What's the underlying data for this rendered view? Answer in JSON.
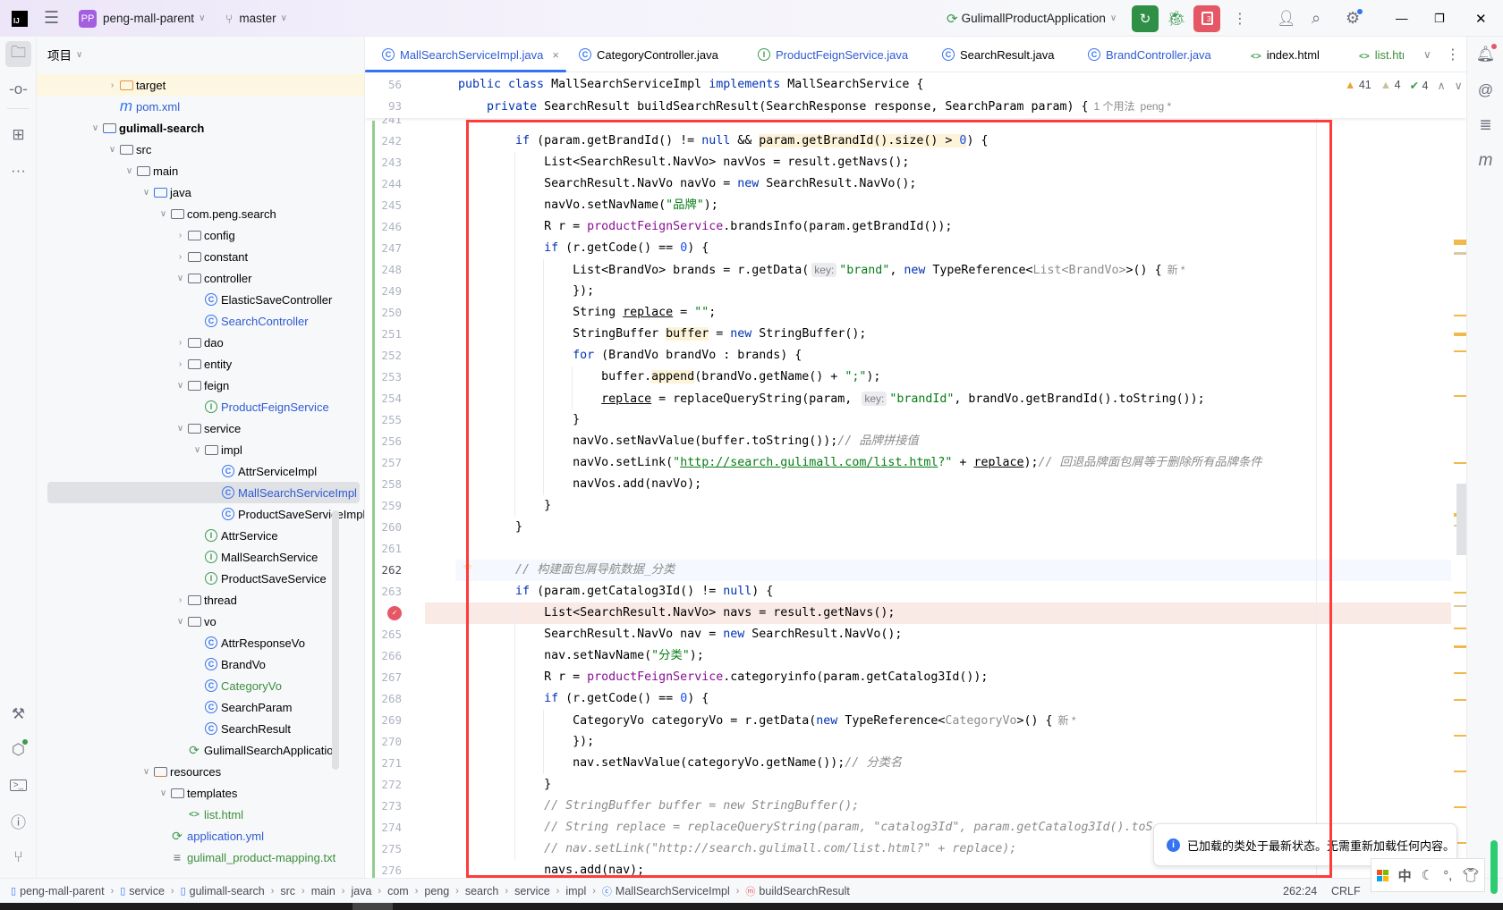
{
  "titlebar": {
    "project_badge": "PP",
    "project_name": "peng-mall-parent",
    "branch": "master",
    "run_config": "GulimallProductApplication",
    "stop_badge": "3"
  },
  "panel": {
    "title": "项目",
    "tree": [
      {
        "label": "target",
        "level": 1,
        "chevron": "closed",
        "icon": "folder-excluded"
      },
      {
        "label": "pom.xml",
        "level": 1,
        "chevron": null,
        "icon": "maven",
        "status": "modified"
      },
      {
        "label": "gulimall-search",
        "level": 0,
        "chevron": "open",
        "icon": "module",
        "bold": true
      },
      {
        "label": "src",
        "level": 1,
        "chevron": "open",
        "icon": "folder"
      },
      {
        "label": "main",
        "level": 2,
        "chevron": "open",
        "icon": "folder"
      },
      {
        "label": "java",
        "level": 3,
        "chevron": "open",
        "icon": "source-folder"
      },
      {
        "label": "com.peng.search",
        "level": 4,
        "chevron": "open",
        "icon": "package"
      },
      {
        "label": "config",
        "level": 5,
        "chevron": "closed",
        "icon": "package"
      },
      {
        "label": "constant",
        "level": 5,
        "chevron": "closed",
        "icon": "package"
      },
      {
        "label": "controller",
        "level": 5,
        "chevron": "open",
        "icon": "package"
      },
      {
        "label": "ElasticSaveController",
        "level": 6,
        "chevron": null,
        "icon": "class"
      },
      {
        "label": "SearchController",
        "level": 6,
        "chevron": null,
        "icon": "class",
        "status": "modified"
      },
      {
        "label": "dao",
        "level": 5,
        "chevron": "closed",
        "icon": "package"
      },
      {
        "label": "entity",
        "level": 5,
        "chevron": "closed",
        "icon": "package"
      },
      {
        "label": "feign",
        "level": 5,
        "chevron": "open",
        "icon": "package"
      },
      {
        "label": "ProductFeignService",
        "level": 6,
        "chevron": null,
        "icon": "interface",
        "status": "modified"
      },
      {
        "label": "service",
        "level": 5,
        "chevron": "open",
        "icon": "package"
      },
      {
        "label": "impl",
        "level": 6,
        "chevron": "open",
        "icon": "package"
      },
      {
        "label": "AttrServiceImpl",
        "level": 7,
        "chevron": null,
        "icon": "class"
      },
      {
        "label": "MallSearchServiceImpl",
        "level": 7,
        "chevron": null,
        "icon": "class",
        "status": "modified",
        "selected": true
      },
      {
        "label": "ProductSaveServiceImpl",
        "level": 7,
        "chevron": null,
        "icon": "class"
      },
      {
        "label": "AttrService",
        "level": 6,
        "chevron": null,
        "icon": "interface"
      },
      {
        "label": "MallSearchService",
        "level": 6,
        "chevron": null,
        "icon": "interface"
      },
      {
        "label": "ProductSaveService",
        "level": 6,
        "chevron": null,
        "icon": "interface"
      },
      {
        "label": "thread",
        "level": 5,
        "chevron": "closed",
        "icon": "package"
      },
      {
        "label": "vo",
        "level": 5,
        "chevron": "open",
        "icon": "package"
      },
      {
        "label": "AttrResponseVo",
        "level": 6,
        "chevron": null,
        "icon": "class"
      },
      {
        "label": "BrandVo",
        "level": 6,
        "chevron": null,
        "icon": "class"
      },
      {
        "label": "CategoryVo",
        "level": 6,
        "chevron": null,
        "icon": "class",
        "status": "added"
      },
      {
        "label": "SearchParam",
        "level": 6,
        "chevron": null,
        "icon": "class"
      },
      {
        "label": "SearchResult",
        "level": 6,
        "chevron": null,
        "icon": "class"
      },
      {
        "label": "GulimallSearchApplication",
        "level": 5,
        "chevron": null,
        "icon": "spring-boot"
      },
      {
        "label": "resources",
        "level": 3,
        "chevron": "open",
        "icon": "resources-folder"
      },
      {
        "label": "templates",
        "level": 4,
        "chevron": "open",
        "icon": "folder"
      },
      {
        "label": "list.html",
        "level": 5,
        "chevron": null,
        "icon": "html",
        "status": "added"
      },
      {
        "label": "application.yml",
        "level": 4,
        "chevron": null,
        "icon": "yaml",
        "status": "modified"
      },
      {
        "label": "gulimall_product-mapping.txt",
        "level": 4,
        "chevron": null,
        "icon": "text",
        "status": "added"
      }
    ]
  },
  "tabs": [
    {
      "label": "MallSearchServiceImpl.java",
      "icon": "class",
      "active": true,
      "status": "modified"
    },
    {
      "label": "CategoryController.java",
      "icon": "class"
    },
    {
      "label": "ProductFeignService.java",
      "icon": "interface",
      "status": "modified"
    },
    {
      "label": "SearchResult.java",
      "icon": "class"
    },
    {
      "label": "BrandController.java",
      "icon": "class",
      "status": "modified"
    },
    {
      "label": "index.html",
      "icon": "html"
    },
    {
      "label": "list.htm",
      "icon": "html",
      "status": "added"
    }
  ],
  "inspections": {
    "warnings": "41",
    "weak_warnings": "4",
    "typos": "4"
  },
  "sticky": [
    {
      "n": "56",
      "tokens": [
        [
          "kw",
          "public class "
        ],
        [
          "p",
          "MallSearchServiceImpl "
        ],
        [
          "kw",
          "implements "
        ],
        [
          "p",
          "MallSearchService {"
        ]
      ]
    },
    {
      "n": "93",
      "tokens": [
        [
          "p",
          "    "
        ],
        [
          "kw",
          "private "
        ],
        [
          "p",
          "SearchResult buildSearchResult(SearchResponse response, SearchParam param) {"
        ],
        [
          "author",
          "1 个用法"
        ],
        [
          "author",
          "peng *"
        ]
      ]
    }
  ],
  "code": [
    {
      "n": "241",
      "tokens": []
    },
    {
      "n": "242",
      "tokens": [
        [
          "p",
          "        "
        ],
        [
          "kw",
          "if"
        ],
        [
          "p",
          " (param.getBrandId() != "
        ],
        [
          "kw",
          "null"
        ],
        [
          "p",
          " && "
        ],
        [
          "hl",
          "param.getBrandId().size() > "
        ],
        [
          "hlnum",
          "0"
        ],
        [
          "p",
          ") {"
        ]
      ]
    },
    {
      "n": "243",
      "tokens": [
        [
          "p",
          "            List<SearchResult.NavVo> navVos = result.getNavs();"
        ]
      ]
    },
    {
      "n": "244",
      "tokens": [
        [
          "p",
          "            SearchResult.NavVo navVo = "
        ],
        [
          "kw",
          "new"
        ],
        [
          "p",
          " SearchResult.NavVo();"
        ]
      ]
    },
    {
      "n": "245",
      "tokens": [
        [
          "p",
          "            navVo.setNavName("
        ],
        [
          "str",
          "\"品牌\""
        ],
        [
          "p",
          ");"
        ]
      ]
    },
    {
      "n": "246",
      "tokens": [
        [
          "p",
          "            R r = "
        ],
        [
          "fld",
          "productFeignService"
        ],
        [
          "p",
          ".brandsInfo(param.getBrandId());"
        ]
      ]
    },
    {
      "n": "247",
      "tokens": [
        [
          "p",
          "            "
        ],
        [
          "kw",
          "if"
        ],
        [
          "p",
          " (r.getCode() == "
        ],
        [
          "num",
          "0"
        ],
        [
          "p",
          ") {"
        ]
      ]
    },
    {
      "n": "248",
      "tokens": [
        [
          "p",
          "                List<BrandVo> brands = r.getData("
        ],
        [
          "hint",
          "key:"
        ],
        [
          "str",
          "\"brand\""
        ],
        [
          "p",
          ", "
        ],
        [
          "kw",
          "new"
        ],
        [
          "p",
          " TypeReference<"
        ],
        [
          "grey",
          "List<BrandVo>"
        ],
        [
          "p",
          ">() {"
        ],
        [
          "author",
          "新 *"
        ]
      ]
    },
    {
      "n": "249",
      "tokens": [
        [
          "p",
          "                });"
        ]
      ]
    },
    {
      "n": "250",
      "tokens": [
        [
          "p",
          "                String "
        ],
        [
          "ul",
          "replace"
        ],
        [
          "p",
          " = "
        ],
        [
          "str",
          "\"\""
        ],
        [
          "p",
          ";"
        ]
      ]
    },
    {
      "n": "251",
      "tokens": [
        [
          "p",
          "                StringBuffer "
        ],
        [
          "hl",
          "buffer"
        ],
        [
          "p",
          " = "
        ],
        [
          "kw",
          "new"
        ],
        [
          "p",
          " StringBuffer();"
        ]
      ]
    },
    {
      "n": "252",
      "tokens": [
        [
          "p",
          "                "
        ],
        [
          "kw",
          "for"
        ],
        [
          "p",
          " (BrandVo brandVo : brands) {"
        ]
      ]
    },
    {
      "n": "253",
      "tokens": [
        [
          "p",
          "                    buffer."
        ],
        [
          "hl",
          "append"
        ],
        [
          "p",
          "(brandVo.getName() + "
        ],
        [
          "str",
          "\";\""
        ],
        [
          "p",
          ");"
        ]
      ]
    },
    {
      "n": "254",
      "tokens": [
        [
          "p",
          "                    "
        ],
        [
          "ul",
          "replace"
        ],
        [
          "p",
          " = replaceQueryString(param, "
        ],
        [
          "hint",
          "key:"
        ],
        [
          "str",
          "\"brandId\""
        ],
        [
          "p",
          ", brandVo.getBrandId().toString());"
        ]
      ]
    },
    {
      "n": "255",
      "tokens": [
        [
          "p",
          "                }"
        ]
      ]
    },
    {
      "n": "256",
      "tokens": [
        [
          "p",
          "                navVo.setNavValue(buffer.toString());"
        ],
        [
          "cm",
          "// 品牌拼接值"
        ]
      ]
    },
    {
      "n": "257",
      "tokens": [
        [
          "p",
          "                navVo.setLink("
        ],
        [
          "str",
          "\""
        ],
        [
          "url",
          "http://search.gulimall.com/list.html"
        ],
        [
          "str",
          "?\""
        ],
        [
          "p",
          " + "
        ],
        [
          "ul",
          "replace"
        ],
        [
          "p",
          ");"
        ],
        [
          "cm",
          "// 回退品牌面包屑等于删除所有品牌条件"
        ]
      ]
    },
    {
      "n": "258",
      "tokens": [
        [
          "p",
          "                navVos.add(navVo);"
        ]
      ]
    },
    {
      "n": "259",
      "tokens": [
        [
          "p",
          "            }"
        ]
      ]
    },
    {
      "n": "260",
      "tokens": [
        [
          "p",
          "        }"
        ]
      ]
    },
    {
      "n": "261",
      "tokens": []
    },
    {
      "n": "262",
      "tokens": [
        [
          "p",
          "        "
        ],
        [
          "cm",
          "// 构建面包屑导航数据_分类"
        ]
      ],
      "current": true
    },
    {
      "n": "263",
      "tokens": [
        [
          "p",
          "        "
        ],
        [
          "kw",
          "if"
        ],
        [
          "p",
          " (param.getCatalog3Id() != "
        ],
        [
          "kw",
          "null"
        ],
        [
          "p",
          ") {"
        ]
      ]
    },
    {
      "n": "264",
      "tokens": [
        [
          "p",
          "            List<SearchResult.NavVo> navs = result.getNavs();"
        ]
      ],
      "breakpoint": true
    },
    {
      "n": "265",
      "tokens": [
        [
          "p",
          "            SearchResult.NavVo nav = "
        ],
        [
          "kw",
          "new"
        ],
        [
          "p",
          " SearchResult.NavVo();"
        ]
      ]
    },
    {
      "n": "266",
      "tokens": [
        [
          "p",
          "            nav.setNavName("
        ],
        [
          "str",
          "\"分类\""
        ],
        [
          "p",
          ");"
        ]
      ]
    },
    {
      "n": "267",
      "tokens": [
        [
          "p",
          "            R r = "
        ],
        [
          "fld",
          "productFeignService"
        ],
        [
          "p",
          ".categoryinfo(param.getCatalog3Id());"
        ]
      ]
    },
    {
      "n": "268",
      "tokens": [
        [
          "p",
          "            "
        ],
        [
          "kw",
          "if"
        ],
        [
          "p",
          " (r.getCode() == "
        ],
        [
          "num",
          "0"
        ],
        [
          "p",
          ") {"
        ]
      ]
    },
    {
      "n": "269",
      "tokens": [
        [
          "p",
          "                CategoryVo categoryVo = r.getData("
        ],
        [
          "kw",
          "new"
        ],
        [
          "p",
          " TypeReference<"
        ],
        [
          "grey",
          "CategoryVo"
        ],
        [
          "p",
          ">() {"
        ],
        [
          "author",
          "新 *"
        ]
      ]
    },
    {
      "n": "270",
      "tokens": [
        [
          "p",
          "                });"
        ]
      ]
    },
    {
      "n": "271",
      "tokens": [
        [
          "p",
          "                nav.setNavValue(categoryVo.getName());"
        ],
        [
          "cm",
          "// 分类名"
        ]
      ]
    },
    {
      "n": "272",
      "tokens": [
        [
          "p",
          "            }"
        ]
      ]
    },
    {
      "n": "273",
      "tokens": [
        [
          "p",
          "            "
        ],
        [
          "cm",
          "// StringBuffer buffer = new StringBuffer();"
        ]
      ]
    },
    {
      "n": "274",
      "tokens": [
        [
          "p",
          "            "
        ],
        [
          "cm",
          "// String replace = replaceQueryString(param, \"catalog3Id\", param.getCatalog3Id().toS"
        ]
      ]
    },
    {
      "n": "275",
      "tokens": [
        [
          "p",
          "            "
        ],
        [
          "cm",
          "// nav.setLink(\"http://search.gulimall.com/list.html?\" + replace);"
        ]
      ]
    },
    {
      "n": "276",
      "tokens": [
        [
          "p",
          "            navs.add(nav);"
        ]
      ]
    }
  ],
  "notification": {
    "text": "已加载的类处于最新状态。无需重新加载任何内容。",
    "icon": "info-icon"
  },
  "ime": {
    "mode": "中"
  },
  "statusbar": {
    "breadcrumb": [
      "peng-mall-parent",
      "service",
      "gulimall-search",
      "src",
      "main",
      "java",
      "com",
      "peng",
      "search",
      "service",
      "impl",
      "MallSearchServiceImpl",
      "buildSearchResult"
    ],
    "position": "262:24",
    "line_ending": "CRLF"
  },
  "colors": {
    "accent": "#3574f0",
    "run": "#2f8f46",
    "stop": "#e55765",
    "annotation_box": "#ff3b3b",
    "modified": "#2f5bd3",
    "added": "#3d8f3d"
  }
}
